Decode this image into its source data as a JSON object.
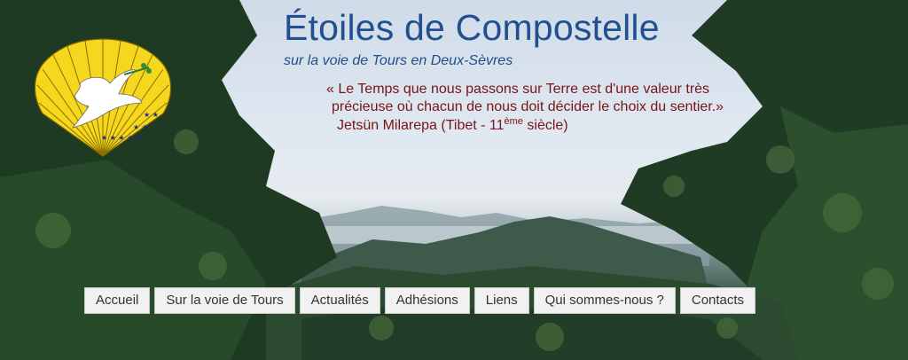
{
  "header": {
    "title": "Étoiles de Compostelle",
    "subtitle": "sur la voie de Tours en Deux-Sèvres",
    "quote_line1": "« Le Temps que nous passons sur Terre est d'une valeur très",
    "quote_line2": "précieuse où chacun de nous doit décider le choix du sentier.»",
    "author_prefix": "Jetsün Milarepa (Tibet - 11",
    "author_sup": "ème",
    "author_suffix": " siècle)"
  },
  "nav": {
    "items": [
      {
        "label": "Accueil"
      },
      {
        "label": "Sur la voie de Tours"
      },
      {
        "label": "Actualités"
      },
      {
        "label": "Adhésions"
      },
      {
        "label": "Liens"
      },
      {
        "label": "Qui sommes-nous ?"
      },
      {
        "label": "Contacts"
      }
    ]
  },
  "colors": {
    "title": "#22508f",
    "quote": "#7a1416",
    "shell": "#f2d21a"
  },
  "icons": {
    "logo": "scallop-shell-with-dove-icon"
  }
}
